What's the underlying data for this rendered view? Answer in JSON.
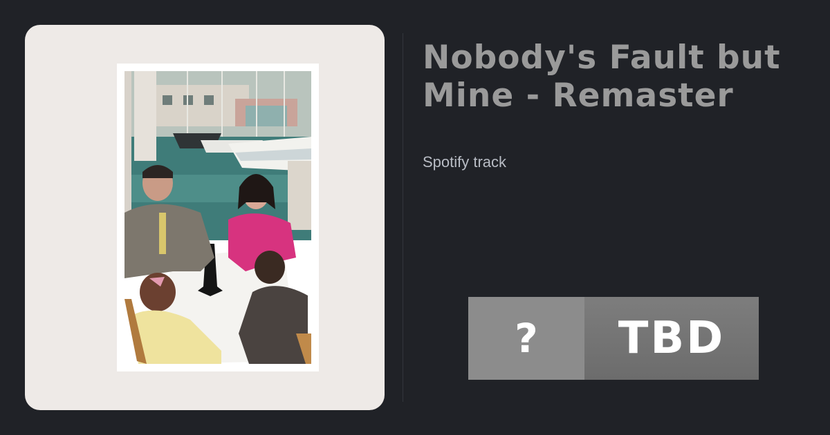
{
  "track": {
    "title": "Nobody's Fault but\nMine - Remaster",
    "source_label": "Spotify track"
  },
  "rating": {
    "symbol": "?",
    "label": "TBD"
  },
  "colors": {
    "background": "#202227",
    "card": "#eeeae7",
    "title": "#9a9a9a",
    "badge_left": "#8c8c8c",
    "badge_right": "#757575"
  }
}
